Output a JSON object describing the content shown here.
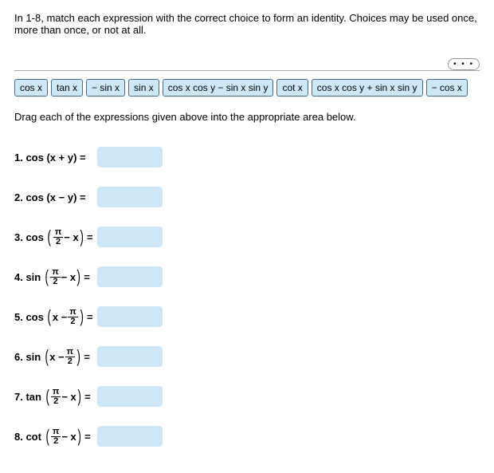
{
  "instructions": "In 1-8, match each expression with the correct choice to form an identity. Choices may be used once, more than once, or not at all.",
  "dots": "• • •",
  "chips": {
    "c0": "cos x",
    "c1": "tan x",
    "c2": "− sin x",
    "c3": "sin x",
    "c4": "cos x cos y − sin x sin y",
    "c5": "cot x",
    "c6": "cos x cos y + sin x sin y",
    "c7": "− cos x"
  },
  "subinstr": "Drag each of the expressions given above into the appropriate area below.",
  "q": {
    "n1": "1. cos (x + y) =",
    "n2": "2. cos (x − y) =",
    "p3a": "3. cos",
    "p4a": "4. sin",
    "p5a": "5. cos",
    "p6a": "6. sin",
    "p7a": "7. tan",
    "p8a": "8. cot",
    "pi": "π",
    "two": "2",
    "minusx": "− x",
    "xminus": "x −"
  }
}
